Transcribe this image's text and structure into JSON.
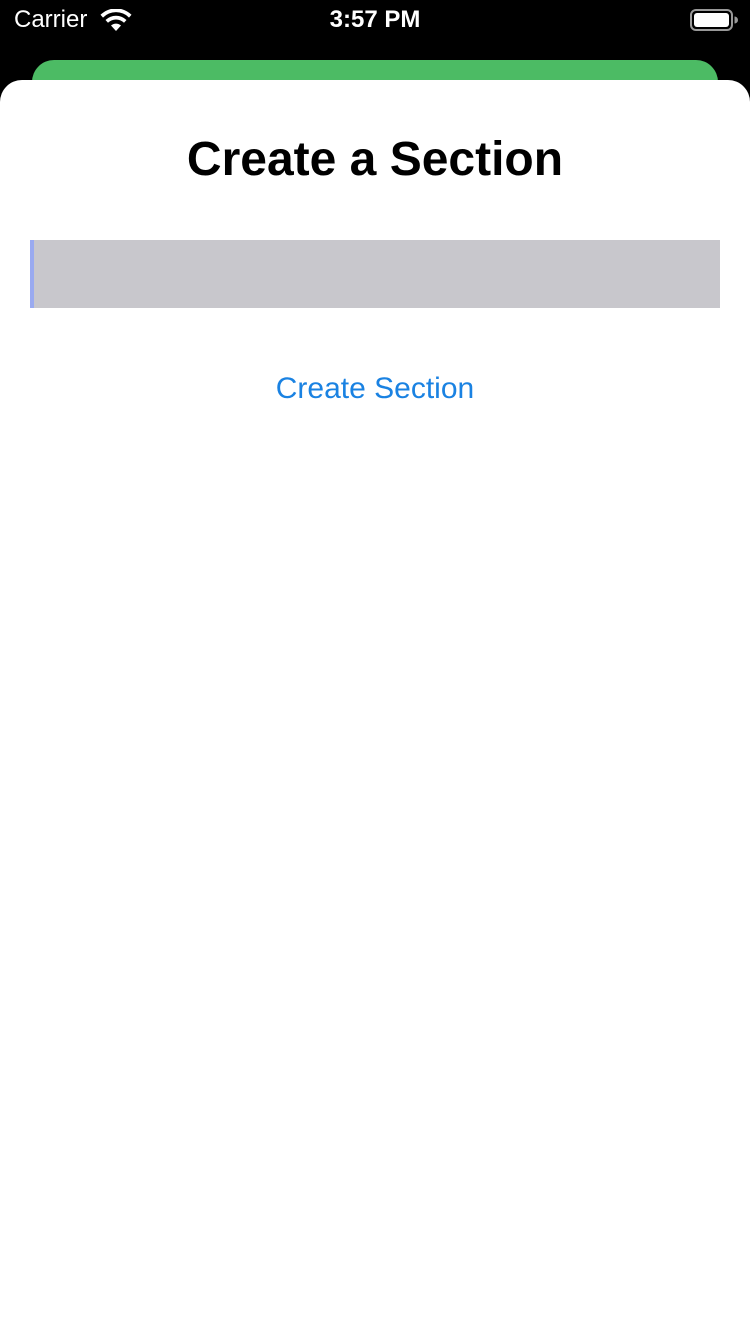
{
  "status_bar": {
    "carrier": "Carrier",
    "time": "3:57 PM",
    "wifi_icon": "wifi-icon",
    "battery_icon": "battery-full-icon"
  },
  "sheet": {
    "title": "Create a Section",
    "name_input": {
      "value": "",
      "placeholder": ""
    },
    "create_button_label": "Create Section"
  },
  "colors": {
    "background_card": "#4cbb64",
    "sheet_background": "#ffffff",
    "input_background": "#c8c7cc",
    "input_cursor": "#9aaaf0",
    "accent_link": "#1a82e2",
    "status_bar_background": "#000000"
  }
}
